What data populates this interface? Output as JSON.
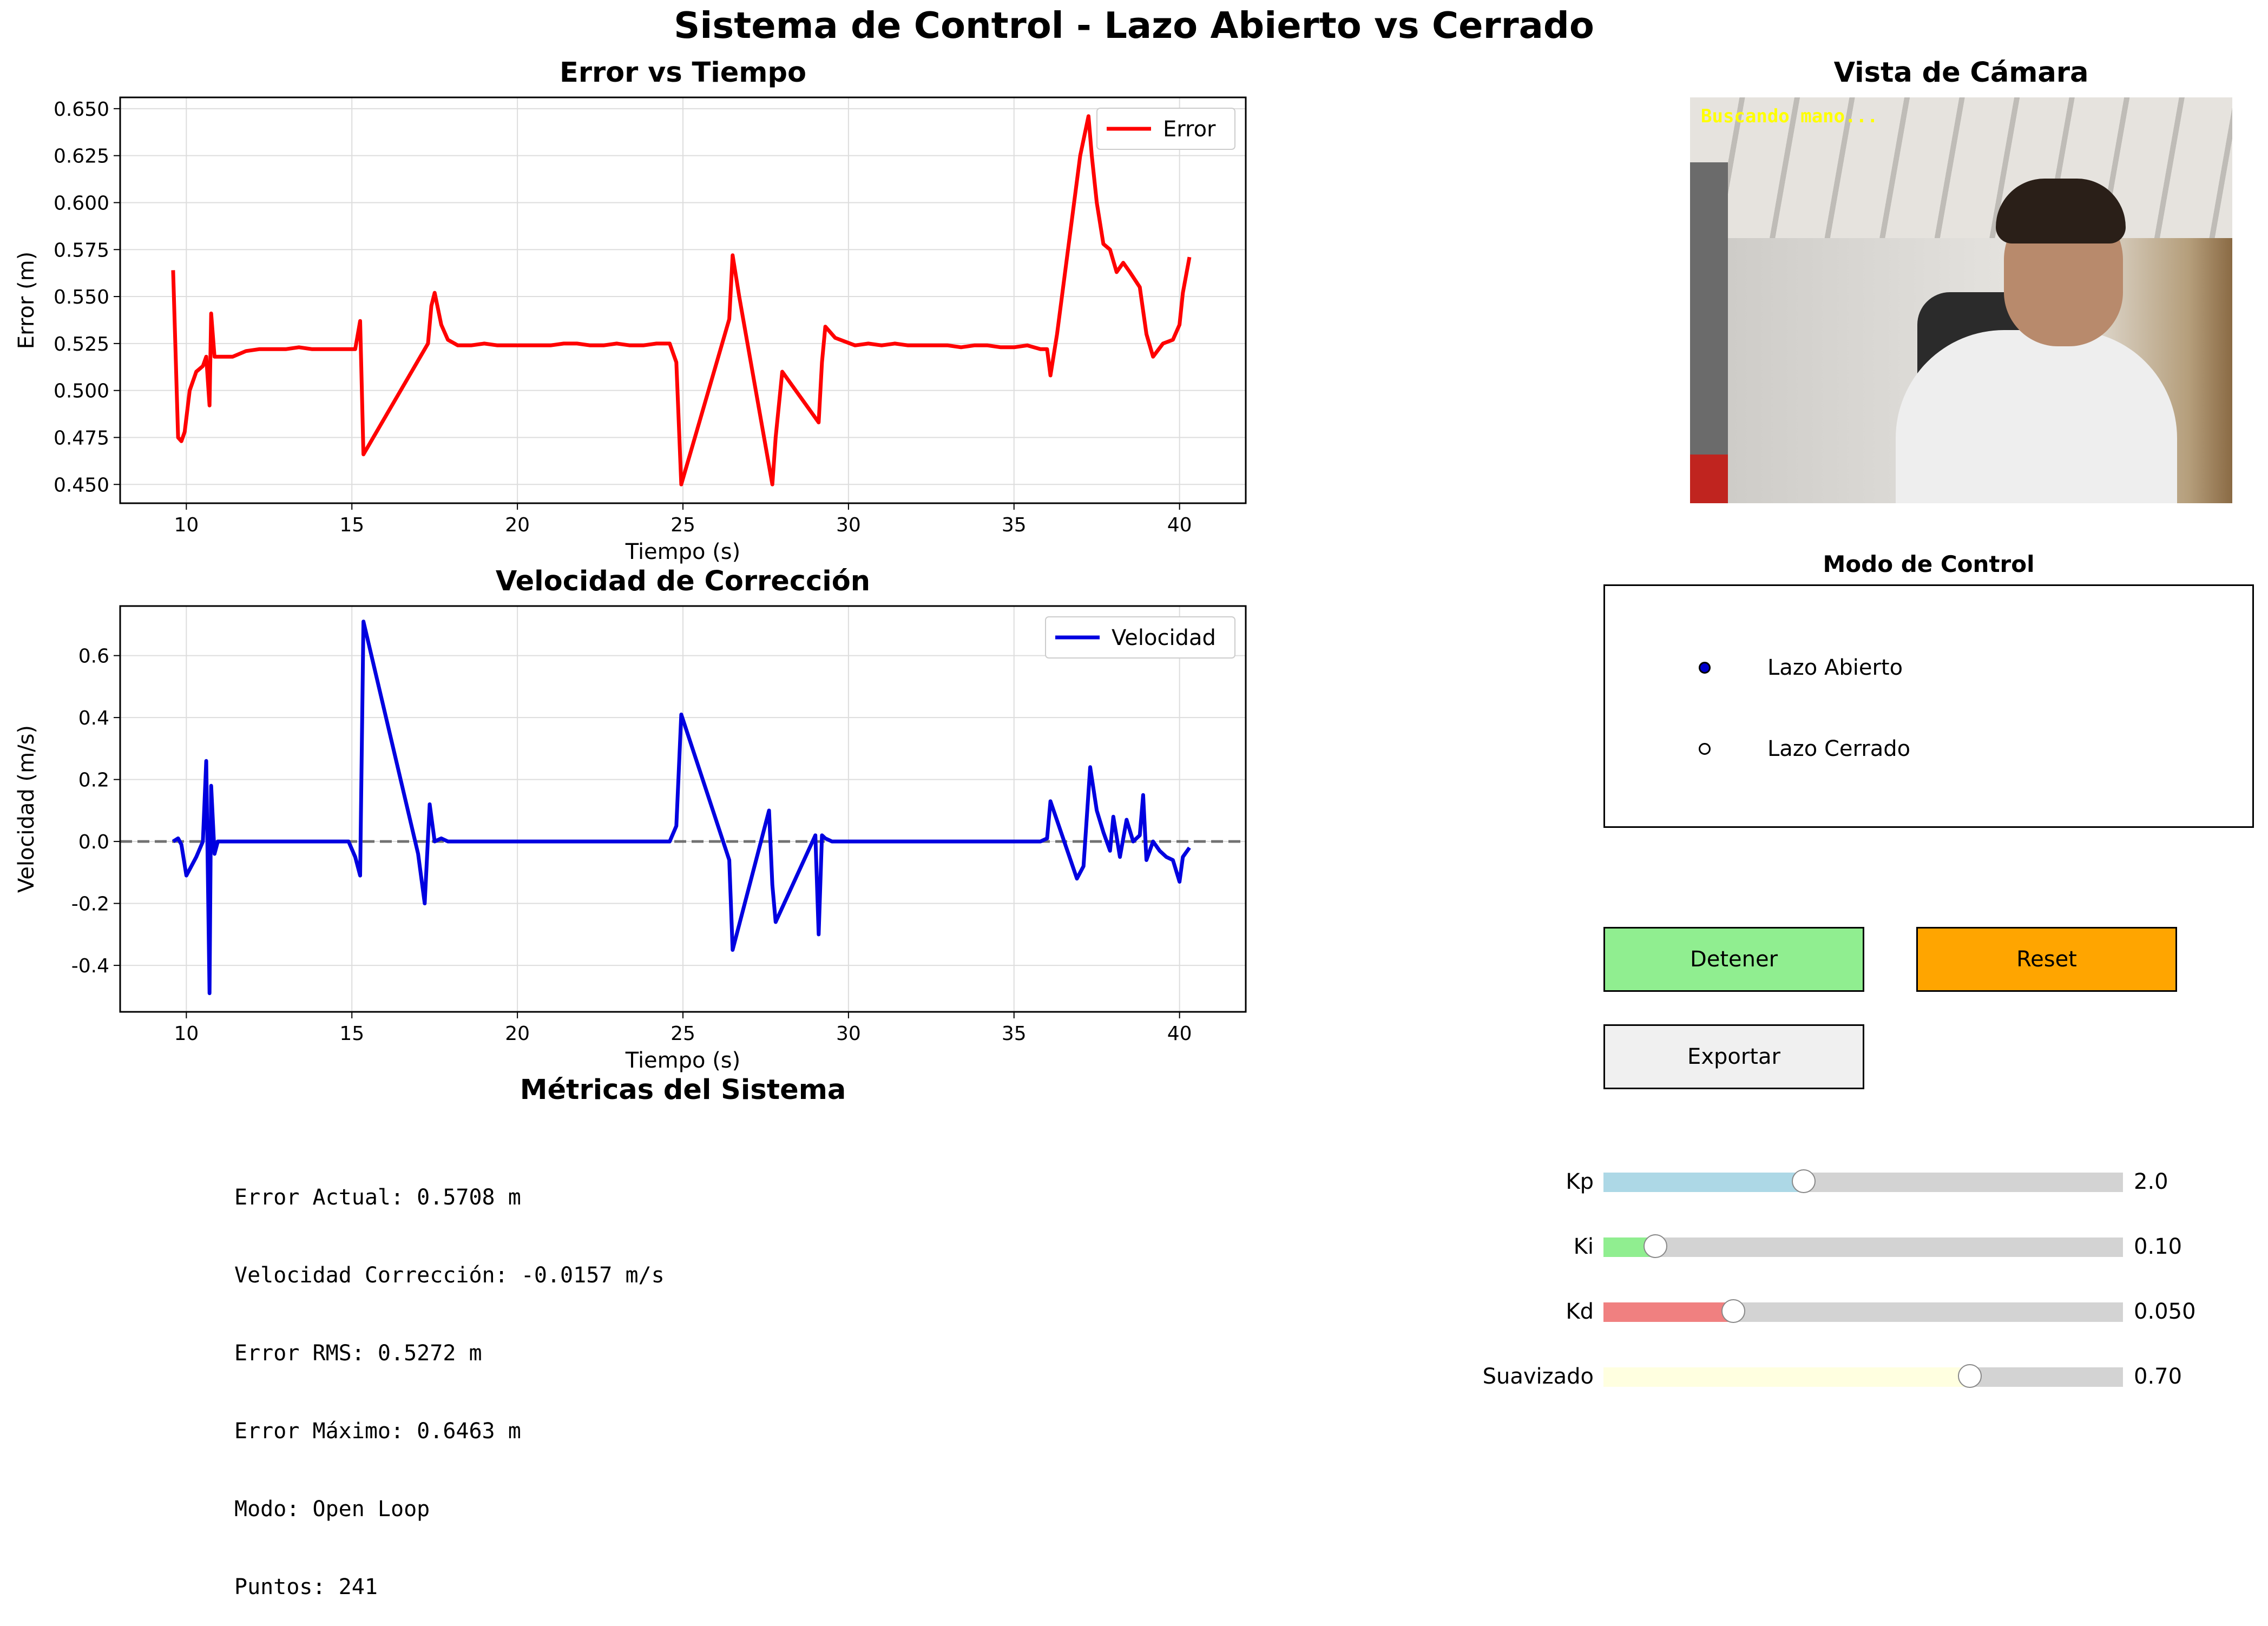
{
  "figure_title": "Sistema de Control - Lazo Abierto vs Cerrado",
  "chart_data": [
    {
      "type": "line",
      "title": "Error vs Tiempo",
      "xlabel": "Tiempo (s)",
      "ylabel": "Error (m)",
      "xlim": [
        8.0,
        42.0
      ],
      "ylim": [
        0.44,
        0.656
      ],
      "xticks": [
        10,
        15,
        20,
        25,
        30,
        35,
        40
      ],
      "yticks": [
        0.45,
        0.475,
        0.5,
        0.525,
        0.55,
        0.575,
        0.6,
        0.625,
        0.65
      ],
      "ytick_format": 3,
      "grid": true,
      "legend": "top-right",
      "series": [
        {
          "name": "Error",
          "color": "#ff0000",
          "x": [
            9.6,
            9.75,
            9.85,
            9.95,
            10.1,
            10.3,
            10.5,
            10.6,
            10.7,
            10.75,
            10.85,
            10.95,
            11.1,
            11.4,
            11.8,
            12.2,
            12.6,
            13.0,
            13.4,
            13.8,
            14.2,
            14.6,
            14.9,
            15.1,
            15.25,
            15.35,
            17.3,
            17.4,
            17.5,
            17.7,
            17.9,
            18.2,
            18.6,
            19.0,
            19.4,
            19.8,
            20.2,
            20.6,
            21.0,
            21.4,
            21.8,
            22.2,
            22.6,
            23.0,
            23.4,
            23.8,
            24.2,
            24.6,
            24.8,
            24.95,
            26.4,
            26.5,
            26.7,
            27.7,
            27.8,
            28.0,
            29.1,
            29.2,
            29.3,
            29.6,
            29.9,
            30.2,
            30.6,
            31.0,
            31.4,
            31.8,
            32.2,
            32.6,
            33.0,
            33.4,
            33.8,
            34.2,
            34.6,
            35.0,
            35.4,
            35.8,
            36.0,
            36.1,
            36.3,
            37.0,
            37.25,
            37.35,
            37.5,
            37.7,
            37.9,
            38.1,
            38.3,
            38.5,
            38.8,
            39.0,
            39.2,
            39.5,
            39.8,
            40.0,
            40.1,
            40.3
          ],
          "values": [
            0.564,
            0.475,
            0.473,
            0.478,
            0.5,
            0.51,
            0.513,
            0.518,
            0.492,
            0.541,
            0.518,
            0.518,
            0.518,
            0.518,
            0.521,
            0.522,
            0.522,
            0.522,
            0.523,
            0.522,
            0.522,
            0.522,
            0.522,
            0.522,
            0.537,
            0.466,
            0.525,
            0.545,
            0.552,
            0.535,
            0.527,
            0.524,
            0.524,
            0.525,
            0.524,
            0.524,
            0.524,
            0.524,
            0.524,
            0.525,
            0.525,
            0.524,
            0.524,
            0.525,
            0.524,
            0.524,
            0.525,
            0.525,
            0.515,
            0.45,
            0.538,
            0.572,
            0.55,
            0.45,
            0.475,
            0.51,
            0.483,
            0.515,
            0.534,
            0.528,
            0.526,
            0.524,
            0.525,
            0.524,
            0.525,
            0.524,
            0.524,
            0.524,
            0.524,
            0.523,
            0.524,
            0.524,
            0.523,
            0.523,
            0.524,
            0.522,
            0.522,
            0.508,
            0.53,
            0.625,
            0.646,
            0.625,
            0.6,
            0.578,
            0.575,
            0.563,
            0.568,
            0.563,
            0.555,
            0.53,
            0.518,
            0.525,
            0.527,
            0.535,
            0.552,
            0.571
          ]
        }
      ]
    },
    {
      "type": "line",
      "title": "Velocidad de Corrección",
      "xlabel": "Tiempo (s)",
      "ylabel": "Velocidad (m/s)",
      "xlim": [
        8.0,
        42.0
      ],
      "ylim": [
        -0.55,
        0.76
      ],
      "xticks": [
        10,
        15,
        20,
        25,
        30,
        35,
        40
      ],
      "yticks": [
        -0.4,
        -0.2,
        0.0,
        0.2,
        0.4,
        0.6
      ],
      "ytick_format": 1,
      "grid": true,
      "legend": "top-right",
      "zero_line": true,
      "series": [
        {
          "name": "Velocidad",
          "color": "#0000e0",
          "x": [
            9.6,
            9.75,
            9.85,
            10.0,
            10.3,
            10.5,
            10.6,
            10.7,
            10.75,
            10.85,
            10.95,
            11.1,
            11.4,
            11.8,
            12.2,
            12.6,
            13.0,
            13.4,
            13.8,
            14.2,
            14.6,
            14.9,
            15.1,
            15.25,
            15.35,
            17.0,
            17.2,
            17.35,
            17.5,
            17.7,
            17.9,
            18.2,
            18.6,
            19.0,
            19.4,
            19.8,
            20.2,
            20.6,
            21.0,
            21.4,
            21.8,
            22.2,
            22.6,
            23.0,
            23.4,
            23.8,
            24.2,
            24.6,
            24.8,
            24.95,
            26.4,
            26.5,
            27.6,
            27.7,
            27.8,
            29.0,
            29.1,
            29.2,
            29.3,
            29.5,
            29.8,
            30.2,
            30.6,
            31.0,
            31.4,
            31.8,
            32.2,
            32.6,
            33.0,
            33.4,
            33.8,
            34.2,
            34.6,
            35.0,
            35.4,
            35.8,
            36.0,
            36.1,
            36.9,
            37.1,
            37.3,
            37.5,
            37.7,
            37.9,
            38.0,
            38.2,
            38.4,
            38.6,
            38.8,
            38.9,
            39.0,
            39.2,
            39.4,
            39.6,
            39.8,
            40.0,
            40.1,
            40.3
          ],
          "values": [
            0.0,
            0.01,
            -0.01,
            -0.11,
            -0.05,
            0.0,
            0.26,
            -0.49,
            0.18,
            -0.04,
            0.0,
            0.0,
            0.0,
            0.0,
            0.0,
            0.0,
            0.0,
            0.0,
            0.0,
            0.0,
            0.0,
            0.0,
            -0.05,
            -0.11,
            0.71,
            -0.04,
            -0.2,
            0.12,
            0.0,
            0.01,
            0.0,
            0.0,
            0.0,
            0.0,
            0.0,
            0.0,
            0.0,
            0.0,
            0.0,
            0.0,
            0.0,
            0.0,
            0.0,
            0.0,
            0.0,
            0.0,
            0.0,
            0.0,
            0.05,
            0.41,
            -0.06,
            -0.35,
            0.1,
            -0.14,
            -0.26,
            0.02,
            -0.3,
            0.02,
            0.01,
            0.0,
            0.0,
            0.0,
            0.0,
            0.0,
            0.0,
            0.0,
            0.0,
            0.0,
            0.0,
            0.0,
            0.0,
            0.0,
            0.0,
            0.0,
            0.0,
            0.0,
            0.01,
            0.13,
            -0.12,
            -0.08,
            0.24,
            0.1,
            0.03,
            -0.03,
            0.08,
            -0.05,
            0.07,
            0.0,
            0.02,
            0.15,
            -0.06,
            0.0,
            -0.03,
            -0.05,
            -0.06,
            -0.13,
            -0.05,
            -0.02
          ]
        }
      ]
    }
  ],
  "camera": {
    "title": "Vista de Cámara",
    "overlay_text": "Buscando mano..."
  },
  "mode": {
    "title": "Modo de Control",
    "options": [
      "Lazo Abierto",
      "Lazo Cerrado"
    ],
    "selected": "Lazo Abierto"
  },
  "buttons": {
    "stop": "Detener",
    "reset": "Reset",
    "export": "Exportar"
  },
  "button_colors": {
    "stop": "#90ee90",
    "reset": "#ffa500",
    "export": "#f0f0f0"
  },
  "metrics": {
    "title": "Métricas del Sistema",
    "lines": [
      "Error Actual: 0.5708 m",
      "Velocidad Corrección: -0.0157 m/s",
      "Error RMS: 0.5272 m",
      "Error Máximo: 0.6463 m",
      "Modo: Open Loop",
      "Puntos: 241"
    ]
  },
  "sliders": [
    {
      "label": "Kp",
      "value": "2.0",
      "fraction": 0.385,
      "color": "#add8e6"
    },
    {
      "label": "Ki",
      "value": "0.10",
      "fraction": 0.1,
      "color": "#90ee90"
    },
    {
      "label": "Kd",
      "value": "0.050",
      "fraction": 0.25,
      "color": "#f08080"
    },
    {
      "label": "Suavizado",
      "value": "0.70",
      "fraction": 0.705,
      "color": "#ffffe0"
    }
  ]
}
